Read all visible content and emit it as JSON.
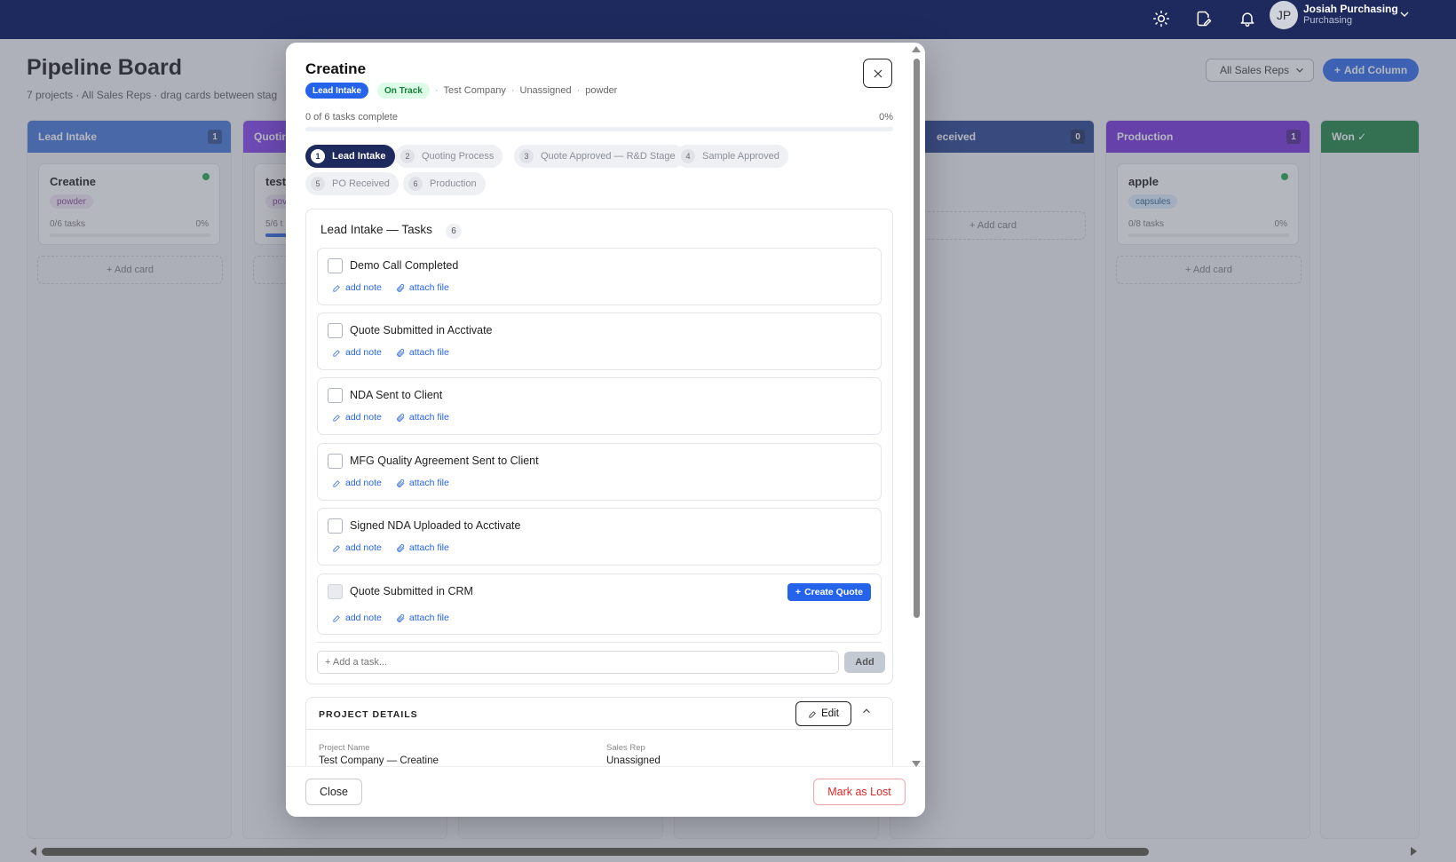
{
  "nav": {
    "user": {
      "initials": "JP",
      "name": "Josiah Purchasing",
      "role": "Purchasing"
    },
    "icons": [
      "sun-icon",
      "note-edit-icon",
      "bell-icon",
      "chevron-down-icon"
    ]
  },
  "page": {
    "title": "Pipeline Board",
    "subtitle": "7 projects · All Sales Reps · drag cards between stag",
    "reps_filter": "All Sales Reps",
    "add_column_label": "Add Column"
  },
  "columns": [
    {
      "name": "Lead Intake",
      "count": "1",
      "color": "#3b6fd8",
      "card": {
        "title": "Creatine",
        "tag": "powder",
        "tasks": "0/6 tasks",
        "pct": "0%",
        "progress": 0
      },
      "add_label": "+ Add card"
    },
    {
      "name": "Quotin",
      "color": "#7c3aed",
      "card": {
        "title": "test",
        "tag": "pov",
        "tasks": "5/6 t",
        "progress": 0.83
      },
      "add_label": ""
    },
    {
      "name": "eceived",
      "count": "0",
      "color": "#1e3a8a",
      "add_label": "+ Add card"
    },
    {
      "name": "Production",
      "count": "1",
      "color": "#6d28d9",
      "card": {
        "title": "apple",
        "tag": "capsules",
        "tasks": "0/8 tasks",
        "pct": "0%",
        "progress": 0
      },
      "add_label": "+ Add card"
    },
    {
      "name": "Won ✓",
      "color": "#15803d"
    }
  ],
  "modal": {
    "title": "Creatine",
    "stage_badge": "Lead Intake",
    "status_badge": "On Track",
    "company": "Test Company",
    "assignee": "Unassigned",
    "form": "powder",
    "progress_text": "0 of 6 tasks complete",
    "progress_pct": "0%",
    "progress": 0,
    "stages": [
      {
        "num": "1",
        "label": "Lead Intake",
        "active": true
      },
      {
        "num": "2",
        "label": "Quoting Process"
      },
      {
        "num": "3",
        "label": "Quote Approved — R&D Stage"
      },
      {
        "num": "4",
        "label": "Sample Approved"
      },
      {
        "num": "5",
        "label": "PO Received"
      },
      {
        "num": "6",
        "label": "Production"
      }
    ],
    "tasks_title": "Lead Intake — Tasks",
    "tasks_count": "6",
    "tasks": [
      {
        "label": "Demo Call Completed"
      },
      {
        "label": "Quote Submitted in Acctivate"
      },
      {
        "label": "NDA Sent to Client"
      },
      {
        "label": "MFG Quality Agreement Sent to Client"
      },
      {
        "label": "Signed NDA Uploaded to Acctivate"
      },
      {
        "label": "Quote Submitted in CRM",
        "action": "Create Quote",
        "disabled": true
      }
    ],
    "add_note_label": "add note",
    "attach_file_label": "attach file",
    "add_task_placeholder": "+ Add a task...",
    "add_task_button": "Add",
    "details": {
      "title": "PROJECT DETAILS",
      "edit_label": "Edit",
      "project_name_label": "Project Name",
      "project_name": "Test Company — Creatine",
      "sales_rep_label": "Sales Rep",
      "sales_rep": "Unassigned"
    },
    "close_label": "Close",
    "mark_lost_label": "Mark as Lost"
  }
}
